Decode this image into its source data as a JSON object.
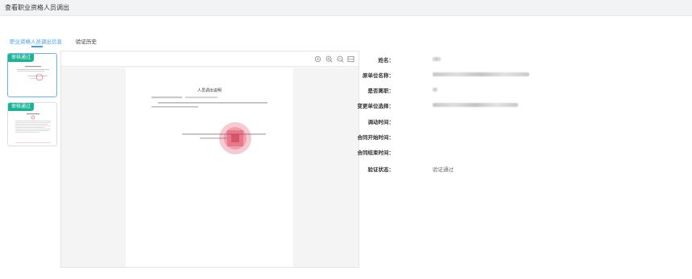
{
  "header": {
    "title": "查看职业资格人员调出"
  },
  "tabs": [
    {
      "label": "职业资格人员调出信息",
      "active": true
    },
    {
      "label": "验证历史",
      "active": false
    }
  ],
  "thumbnails": [
    {
      "badge": "审核通过",
      "selected": true
    },
    {
      "badge": "审核通过",
      "selected": false
    }
  ],
  "viewer": {
    "toolbar_icons": [
      "rotate-icon",
      "zoom-in-icon",
      "zoom-out-icon",
      "fit-page-icon"
    ],
    "document": {
      "title": "人员调出说明",
      "stamp_color": "#e0405a"
    }
  },
  "details": [
    {
      "label": "姓名：",
      "value": "",
      "redacted": true
    },
    {
      "label": "原单位名称：",
      "value": "",
      "redacted": true
    },
    {
      "label": "是否离职：",
      "value": "",
      "redacted": true
    },
    {
      "label": "变更单位选择：",
      "value": "",
      "redacted": true
    },
    {
      "label": "调动时间：",
      "value": ""
    },
    {
      "label": "合同开始时间：",
      "value": ""
    },
    {
      "label": "合同结束时间：",
      "value": ""
    },
    {
      "label": "验证状态：",
      "value": "验证通过"
    }
  ],
  "colors": {
    "accent": "#409eff",
    "badge": "#1ab394",
    "header_bg": "#f2f3f5"
  }
}
